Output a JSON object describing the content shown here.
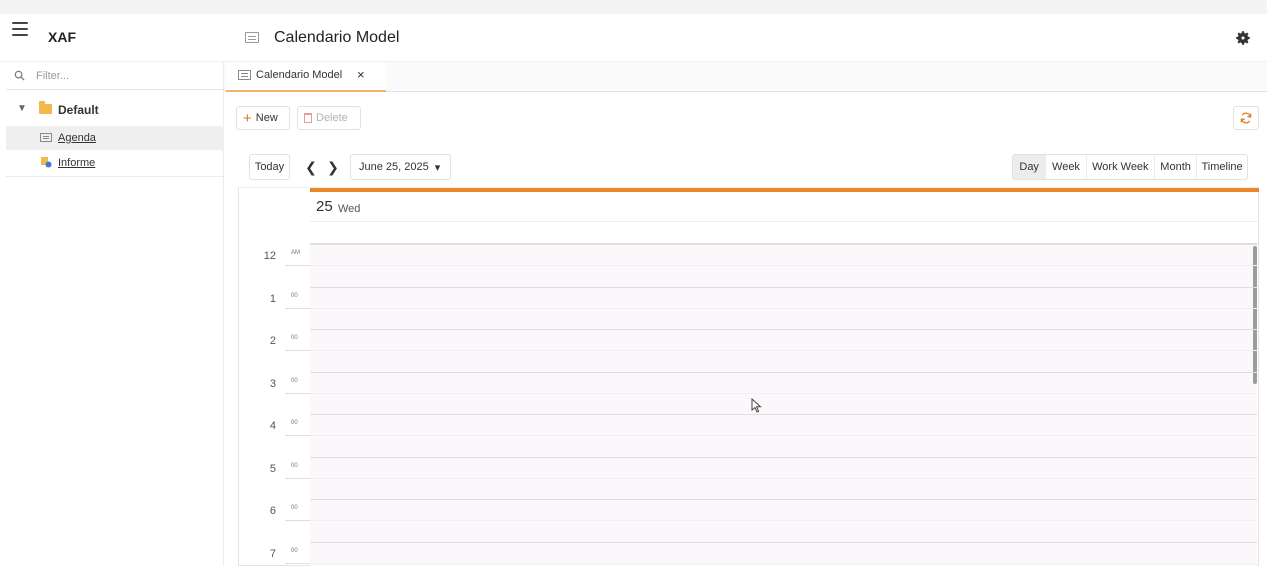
{
  "app": {
    "name": "XAF"
  },
  "header": {
    "title": "Calendario Model",
    "title_icon": "list-view-icon",
    "settings_icon": "gear-icon"
  },
  "sidebar": {
    "filter_placeholder": "Filter...",
    "tree": {
      "group_label": "Default",
      "items": [
        {
          "label": "Agenda",
          "icon": "list-view-icon",
          "selected": true
        },
        {
          "label": "Informe",
          "icon": "report-icon",
          "selected": false
        }
      ]
    }
  },
  "tabs": [
    {
      "label": "Calendario Model",
      "close": "×"
    }
  ],
  "toolbar": {
    "new_label": "New",
    "new_glyph": "+",
    "delete_label": "Delete",
    "refresh_icon": "refresh-icon"
  },
  "scheduler": {
    "today_label": "Today",
    "prev_glyph": "❮",
    "next_glyph": "❯",
    "date_label": "June 25, 2025",
    "date_caret": "▾",
    "views": [
      "Day",
      "Week",
      "Work Week",
      "Month",
      "Timeline"
    ],
    "active_view": "Day",
    "day_number": "25",
    "day_name": "Wed",
    "hours": [
      {
        "hour": "12",
        "suffix": "AM"
      },
      {
        "hour": "1",
        "suffix": "00"
      },
      {
        "hour": "2",
        "suffix": "00"
      },
      {
        "hour": "3",
        "suffix": "00"
      },
      {
        "hour": "4",
        "suffix": "00"
      },
      {
        "hour": "5",
        "suffix": "00"
      },
      {
        "hour": "6",
        "suffix": "00"
      },
      {
        "hour": "7",
        "suffix": "00"
      }
    ]
  },
  "colors": {
    "accent": "#e9872b",
    "tab_underline": "#f5b26b",
    "folder": "#f2b84b",
    "grid_bg": "#fbf7fa"
  }
}
